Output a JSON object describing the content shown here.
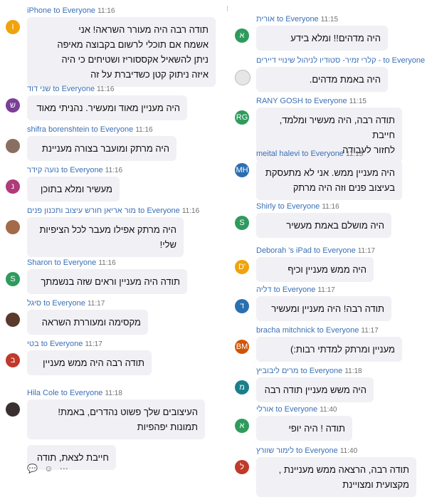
{
  "header": {
    "to": "to",
    "target": "Everyone"
  },
  "left": [
    {
      "sender": "iPhone",
      "time": "11:16",
      "avatar": "I",
      "color": "#f0a30a",
      "lines": [
        "תודה רבה היה מעורר השראה! אני",
        "אשמח אם תוכלי לרשום בקבוצה מאיפה",
        "ניתן להשאיל אקססוריז ושטיחים כי היה",
        "איזה ניתוק קטן כשדיברת על זה"
      ]
    },
    {
      "sender": "שני דוד",
      "time": "11:16",
      "avatar": "ש",
      "color": "#7b3f98",
      "lines": [
        "היה מעניין מאוד ומעשיר. נהניתי מאוד"
      ]
    },
    {
      "sender": "shifra borenshtein",
      "time": "11:16",
      "avatar": "",
      "color": "#8a6f60",
      "lines": [
        "היה מרתק ומועבר בצורה מעניינת"
      ]
    },
    {
      "sender": "נועה קידר",
      "time": "11:16",
      "avatar": "נ",
      "color": "#b03a7a",
      "lines": [
        "מעשיר ומלא בתוכן"
      ]
    },
    {
      "sender": "מור אריאן חורש עיצוב ותכנון פנים",
      "time": "11:16",
      "avatar": "",
      "color": "#a36b4a",
      "lines": [
        "היה מרתק אפילו מעבר לכל הציפיות",
        "שלי!"
      ]
    },
    {
      "sender": "Sharon",
      "time": "11:16",
      "avatar": "S",
      "color": "#2e9b5c",
      "lines": [
        "תודה היה מעניין וראים שזה בנשמתך"
      ]
    },
    {
      "sender": "סיגל",
      "time": "11:17",
      "avatar": "",
      "color": "#5a3a2a",
      "lines": [
        "מקסימה ומעוררת השראה"
      ]
    },
    {
      "sender": "בטי",
      "time": "11:17",
      "avatar": "ב",
      "color": "#c0392b",
      "lines": [
        "תודה רבה היה ממש מעניין"
      ]
    },
    {
      "sender": "Hila Cole",
      "time": "11:18",
      "avatar": "",
      "color": "#3a3030",
      "lines": [
        "העיצובים שלך פשוט נהדרים, באמת!",
        "תמונות יפהפיות"
      ],
      "extra": "חייבת לצאת, תודה"
    }
  ],
  "right": [
    {
      "sender": "אורית",
      "time": "11:15",
      "avatar": "א",
      "color": "#2e9b5c",
      "lines": [
        "היה מדהים!! ומלא בידע"
      ]
    },
    {
      "sender": "קלרי זמיר- סטודיו לניהול שינויי דיירים -",
      "time": "",
      "avatar": "",
      "color": "#e6e6e6",
      "lines": [
        "היה באמת מדהים."
      ]
    },
    {
      "sender": "RANY GOSH",
      "time": "11:15",
      "avatar": "RG",
      "color": "#2e9b5c",
      "lines": [
        "תודה רבה,  היה מעשיר ומלמד, חייבת",
        "לחזור לעבודה"
      ]
    },
    {
      "sender": "meital halevi",
      "time": "11:15",
      "avatar": "MH",
      "color": "#2a6fb0",
      "lines": [
        "היה מעניין ממש. אני לא מתעסקת",
        "בעיצוב פנים וזה היה מרתק"
      ]
    },
    {
      "sender": "Shirly",
      "time": "11:16",
      "avatar": "S",
      "color": "#2e9b5c",
      "lines": [
        "היה מושלם באמת מעשיר"
      ]
    },
    {
      "sender": "Deborah 's iPad",
      "time": "11:17",
      "avatar": "D'",
      "color": "#f0a30a",
      "lines": [
        "היה ממש מעניין וכיף"
      ]
    },
    {
      "sender": "דליה",
      "time": "11:17",
      "avatar": "ד",
      "color": "#2a6fb0",
      "lines": [
        "תודה רבה! היה מעניין ומעשיר"
      ]
    },
    {
      "sender": "bracha mitchnick",
      "time": "11:17",
      "avatar": "BM",
      "color": "#d35400",
      "lines": [
        "מעניין ומרתק למדתי רבות:)"
      ]
    },
    {
      "sender": "מרים ליבוביץ",
      "time": "11:18",
      "avatar": "מ",
      "color": "#1a7f8a",
      "lines": [
        "היה משש מעניין תודה רבה"
      ]
    },
    {
      "sender": "אורלי",
      "time": "11:40",
      "avatar": "א",
      "color": "#2e9b5c",
      "lines": [
        "תודה ! היה יופי"
      ]
    },
    {
      "sender": "לימור שוורץ",
      "time": "11:40",
      "avatar": "ל",
      "color": "#c0392b",
      "lines": [
        "תודה רבה, הרצאה ממש מעניינת ,",
        "מקצועית ומצויינת"
      ]
    }
  ],
  "toolbar": {
    "icons": [
      "reply-icon",
      "emoji-icon",
      "more-icon"
    ],
    "glyphs": [
      "💬",
      "☺",
      "⋯"
    ]
  }
}
